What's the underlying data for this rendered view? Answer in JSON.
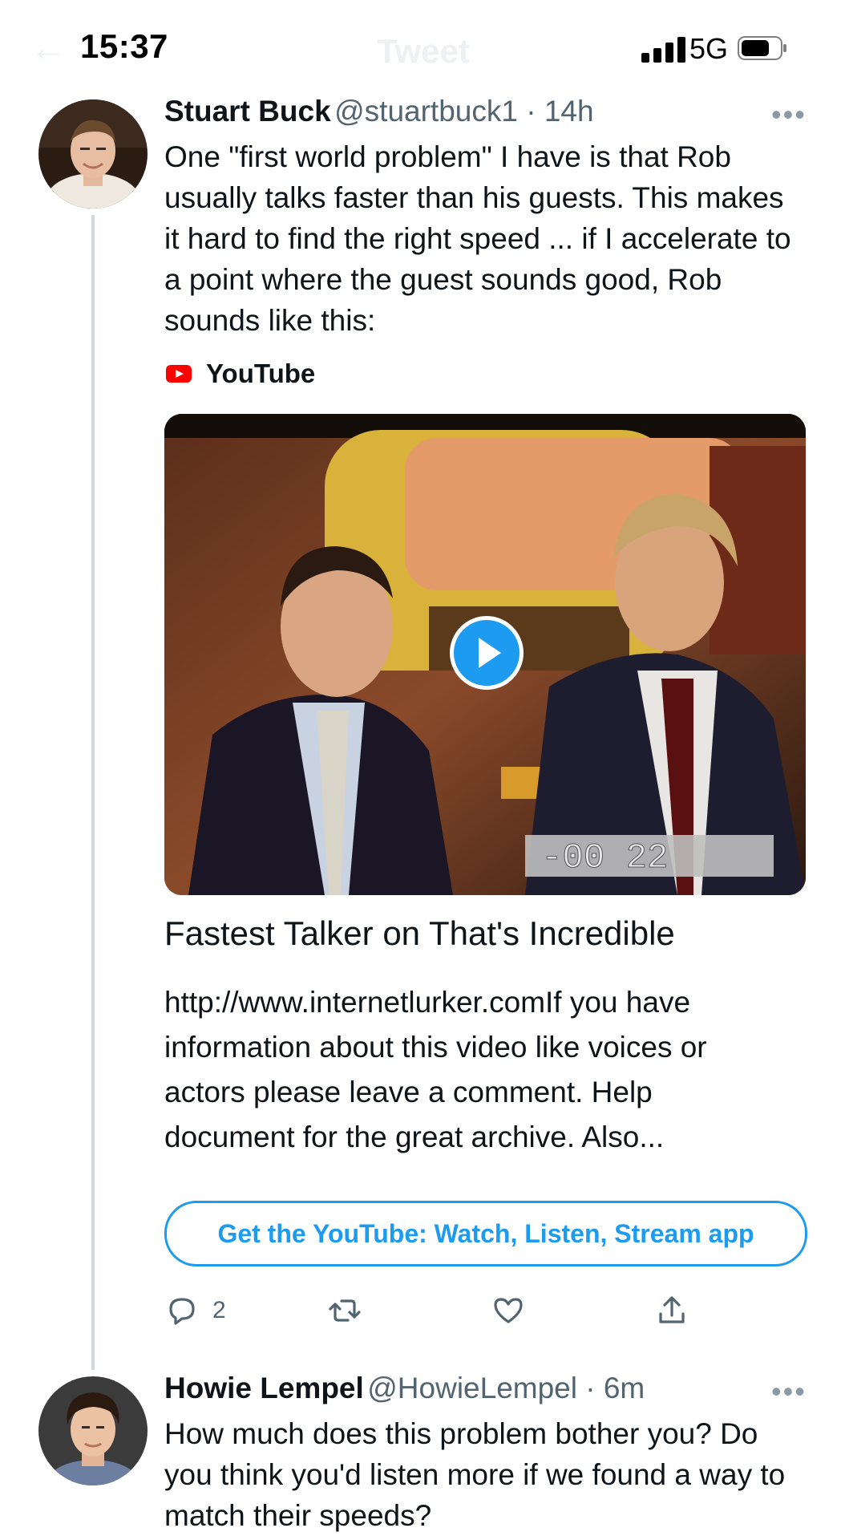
{
  "status_bar": {
    "time": "15:37",
    "network": "5G",
    "ghost_title": "Tweet"
  },
  "tweet1": {
    "name": "Stuart Buck",
    "handle": "@stuartbuck1 · 14h",
    "text": "One \"first world problem\" I have is that Rob usually talks faster than his guests. This makes it hard to find the right speed ... if I accelerate to a point where the guest sounds good, Rob sounds like this:",
    "source_label": "YouTube",
    "card": {
      "timecode": "-00 22",
      "title": "Fastest Talker on That's Incredible",
      "description": "http://www.internetlurker.comIf you have information about this video like voices or actors please leave a comment. Help document for the great archive. Also..."
    },
    "app_button": "Get the YouTube: Watch, Listen, Stream app",
    "actions": {
      "reply_count": "2"
    }
  },
  "tweet2": {
    "name": "Howie Lempel",
    "handle": "@HowieLempel · 6m",
    "text": "How much does this problem bother you? Do you think you'd listen more if we found a way to match their speeds?"
  },
  "colors": {
    "accent": "#1d9bf0",
    "youtube_red": "#ff0000",
    "secondary_text": "#536471",
    "thread_line": "#cfd9de"
  }
}
